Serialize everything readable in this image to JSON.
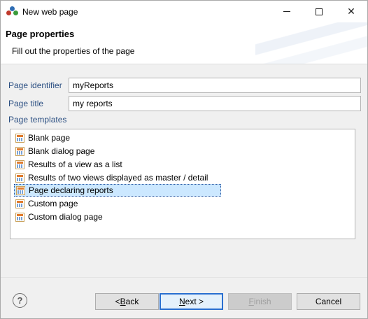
{
  "window": {
    "title": "New web page"
  },
  "header": {
    "title": "Page properties",
    "description": "Fill out the properties of the page"
  },
  "form": {
    "page_identifier_label": "Page identifier",
    "page_identifier_value": "myReports",
    "page_title_label": "Page title",
    "page_title_value": "my reports",
    "page_templates_label": "Page templates"
  },
  "templates": {
    "selected_index": 4,
    "items": [
      {
        "label": "Blank page",
        "icon": "template-icon"
      },
      {
        "label": "Blank dialog page",
        "icon": "template-icon"
      },
      {
        "label": "Results of a view as a list",
        "icon": "template-icon"
      },
      {
        "label": "Results of two views displayed as master / detail",
        "icon": "template-icon"
      },
      {
        "label": "Page declaring reports",
        "icon": "template-icon"
      },
      {
        "label": "Custom page",
        "icon": "template-icon"
      },
      {
        "label": "Custom dialog page",
        "icon": "template-icon"
      }
    ]
  },
  "buttons": {
    "back": {
      "prefix": "< ",
      "mnemonic": "B",
      "rest": "ack"
    },
    "next": {
      "mnemonic": "N",
      "rest": "ext >"
    },
    "finish": {
      "mnemonic": "F",
      "rest": "inish"
    },
    "cancel": {
      "label": "Cancel"
    },
    "help_icon": "help-icon"
  },
  "colors": {
    "label_text": "#2b4f82",
    "selection_bg": "#cce8ff",
    "default_button_border": "#2a6fd0"
  }
}
